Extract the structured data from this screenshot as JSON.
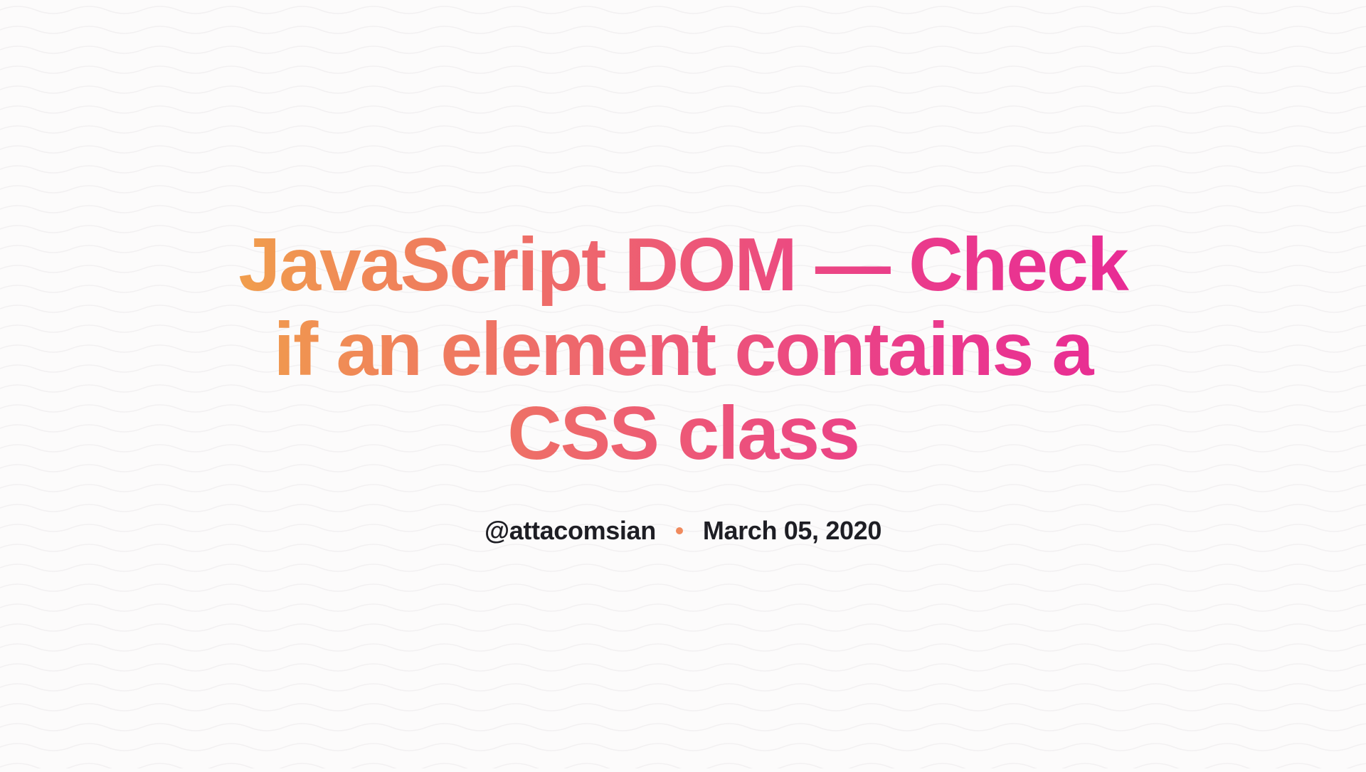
{
  "title": "JavaScript DOM — Check if an element contains a CSS class",
  "meta": {
    "handle": "@attacomsian",
    "date": "March 05, 2020"
  },
  "colors": {
    "gradient_start": "#f1a24a",
    "gradient_end": "#e82a95",
    "dot": "#f08a5d",
    "text": "#1e1e24",
    "bg": "#fcfbfb"
  }
}
